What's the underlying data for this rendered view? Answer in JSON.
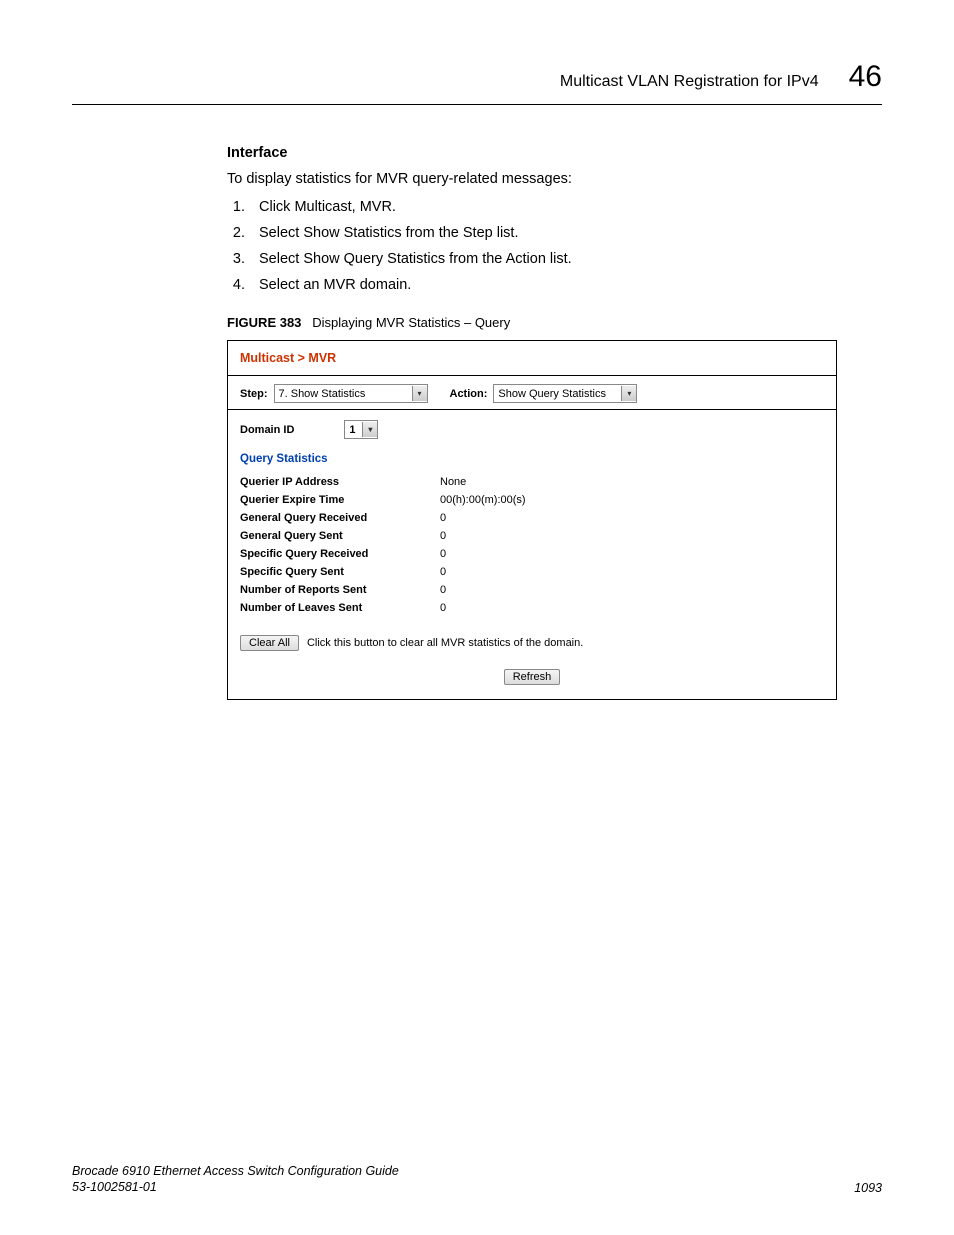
{
  "header": {
    "title": "Multicast VLAN Registration for IPv4",
    "chapter": "46"
  },
  "section": {
    "heading": "Interface",
    "intro": "To display statistics for MVR query-related messages:",
    "steps": [
      "Click Multicast, MVR.",
      "Select Show Statistics from the Step list.",
      "Select Show Query Statistics from the Action list.",
      "Select an MVR domain."
    ]
  },
  "figure": {
    "label": "FIGURE 383",
    "caption": "Displaying MVR Statistics – Query"
  },
  "ui": {
    "breadcrumb": "Multicast > MVR",
    "step_label": "Step:",
    "step_value": "7. Show Statistics",
    "action_label": "Action:",
    "action_value": "Show Query Statistics",
    "domain_label": "Domain ID",
    "domain_value": "1",
    "section_title": "Query Statistics",
    "rows": [
      {
        "k": "Querier IP Address",
        "v": "None"
      },
      {
        "k": "Querier Expire Time",
        "v": "00(h):00(m):00(s)"
      },
      {
        "k": "General Query Received",
        "v": "0"
      },
      {
        "k": "General Query Sent",
        "v": "0"
      },
      {
        "k": "Specific Query Received",
        "v": "0"
      },
      {
        "k": "Specific Query Sent",
        "v": "0"
      },
      {
        "k": "Number of Reports Sent",
        "v": "0"
      },
      {
        "k": "Number of Leaves Sent",
        "v": "0"
      }
    ],
    "clear_button": "Clear All",
    "clear_text": "Click this button to clear all MVR statistics of the domain.",
    "refresh_button": "Refresh"
  },
  "footer": {
    "line1": "Brocade 6910 Ethernet Access Switch Configuration Guide",
    "line2": "53-1002581-01",
    "page": "1093"
  }
}
